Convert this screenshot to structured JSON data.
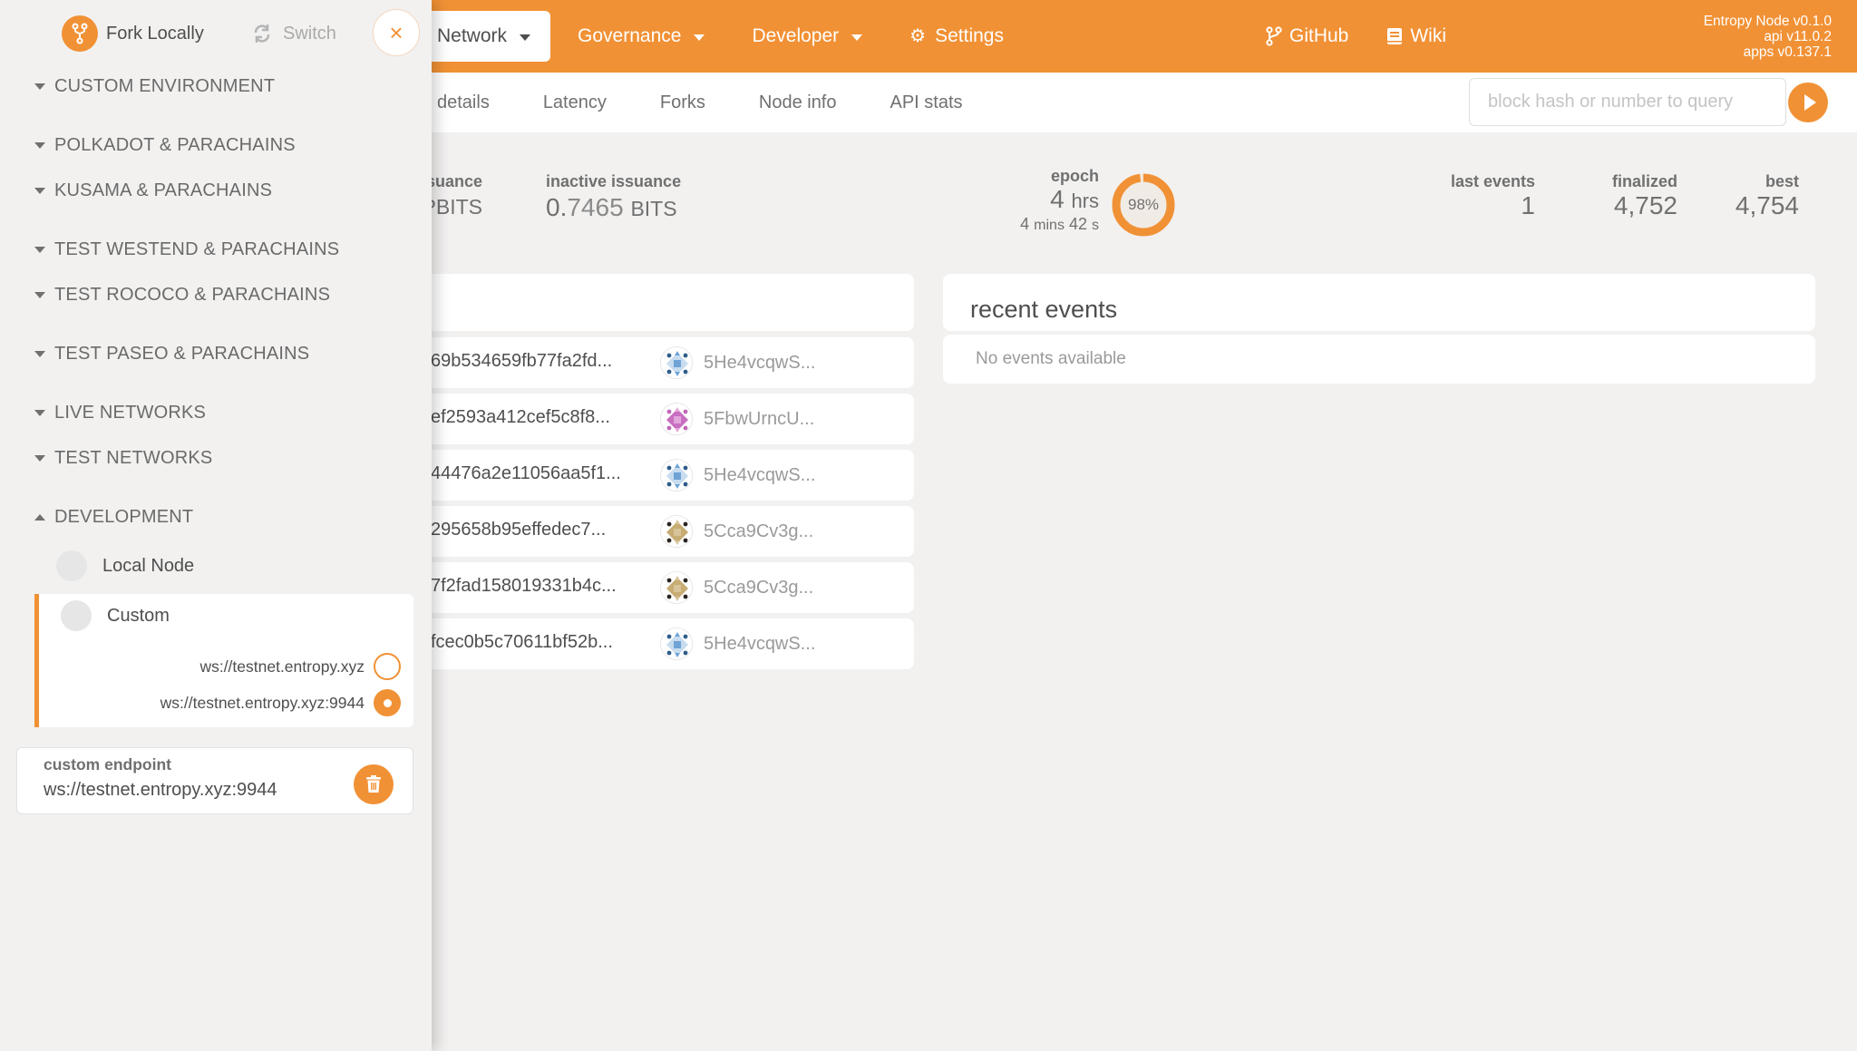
{
  "colors": {
    "accent": "#f19135",
    "background": "#f2f1f0",
    "text": "#4e4e4e"
  },
  "topnav": {
    "items": [
      {
        "label": "Network",
        "icon": "caret-down-icon",
        "active": true
      },
      {
        "label": "Governance",
        "icon": "caret-down-icon"
      },
      {
        "label": "Developer",
        "icon": "caret-down-icon"
      },
      {
        "label": "Settings",
        "icon": "gear-icon"
      }
    ],
    "links": [
      {
        "label": "GitHub",
        "icon": "git-branch-icon"
      },
      {
        "label": "Wiki",
        "icon": "book-icon"
      }
    ],
    "versions": [
      "Entropy Node v0.1.0",
      "api v11.0.2",
      "apps v0.137.1"
    ]
  },
  "subnav": {
    "tabs": [
      "details",
      "Latency",
      "Forks",
      "Node info",
      "API stats"
    ],
    "query_placeholder": "block hash or number to query"
  },
  "summary": {
    "issuance_label": "suance",
    "issuance_unit": "PBITS",
    "inactive_label": "inactive issuance",
    "inactive_int": "0.",
    "inactive_frac": "7465",
    "inactive_unit": "BITS",
    "epoch_label": "epoch",
    "epoch_main_value": "4",
    "epoch_main_unit": "hrs",
    "epoch_sub_min": "4",
    "epoch_sub_min_unit": "mins",
    "epoch_sub_sec": "42",
    "epoch_sub_sec_unit": "s",
    "epoch_progress_percent": 98,
    "epoch_progress_label": "98%",
    "last_events_label": "last events",
    "last_events_value": "1",
    "finalized_label": "finalized",
    "finalized_value": "4,752",
    "best_label": "best",
    "best_value": "4,754"
  },
  "blocks": [
    {
      "hash": "69b534659fb77fa2fd...",
      "author": "5He4vcqwS...",
      "identicon": "blue"
    },
    {
      "hash": "ef2593a412cef5c8f8...",
      "author": "5FbwUrncU...",
      "identicon": "pink"
    },
    {
      "hash": "44476a2e11056aa5f1...",
      "author": "5He4vcqwS...",
      "identicon": "blue"
    },
    {
      "hash": "295658b95effedec7...",
      "author": "5Cca9Cv3g...",
      "identicon": "tan"
    },
    {
      "hash": "7f2fad158019331b4c...",
      "author": "5Cca9Cv3g...",
      "identicon": "tan"
    },
    {
      "hash": "fcec0b5c70611bf52b...",
      "author": "5He4vcqwS...",
      "identicon": "blue"
    }
  ],
  "events": {
    "title": "recent events",
    "empty": "No events available"
  },
  "sidebar": {
    "fork_label": "Fork Locally",
    "switch_label": "Switch",
    "close_icon": "×",
    "groups": [
      {
        "label": "CUSTOM ENVIRONMENT",
        "expanded": false
      },
      {
        "label": "POLKADOT & PARACHAINS",
        "expanded": false
      },
      {
        "label": "KUSAMA & PARACHAINS",
        "expanded": false
      },
      {
        "label": "TEST WESTEND & PARACHAINS",
        "expanded": false
      },
      {
        "label": "TEST ROCOCO & PARACHAINS",
        "expanded": false
      },
      {
        "label": "TEST PASEO & PARACHAINS",
        "expanded": false
      },
      {
        "label": "LIVE NETWORKS",
        "expanded": false
      },
      {
        "label": "TEST NETWORKS",
        "expanded": false
      },
      {
        "label": "DEVELOPMENT",
        "expanded": true
      }
    ],
    "dev_items": [
      {
        "label": "Local Node"
      },
      {
        "label": "Custom",
        "selected": true
      }
    ],
    "endpoints": [
      {
        "url": "ws://testnet.entropy.xyz",
        "checked": false
      },
      {
        "url": "ws://testnet.entropy.xyz:9944",
        "checked": true
      }
    ],
    "custom_endpoint_label": "custom endpoint",
    "custom_endpoint_value": "ws://testnet.entropy.xyz:9944"
  }
}
